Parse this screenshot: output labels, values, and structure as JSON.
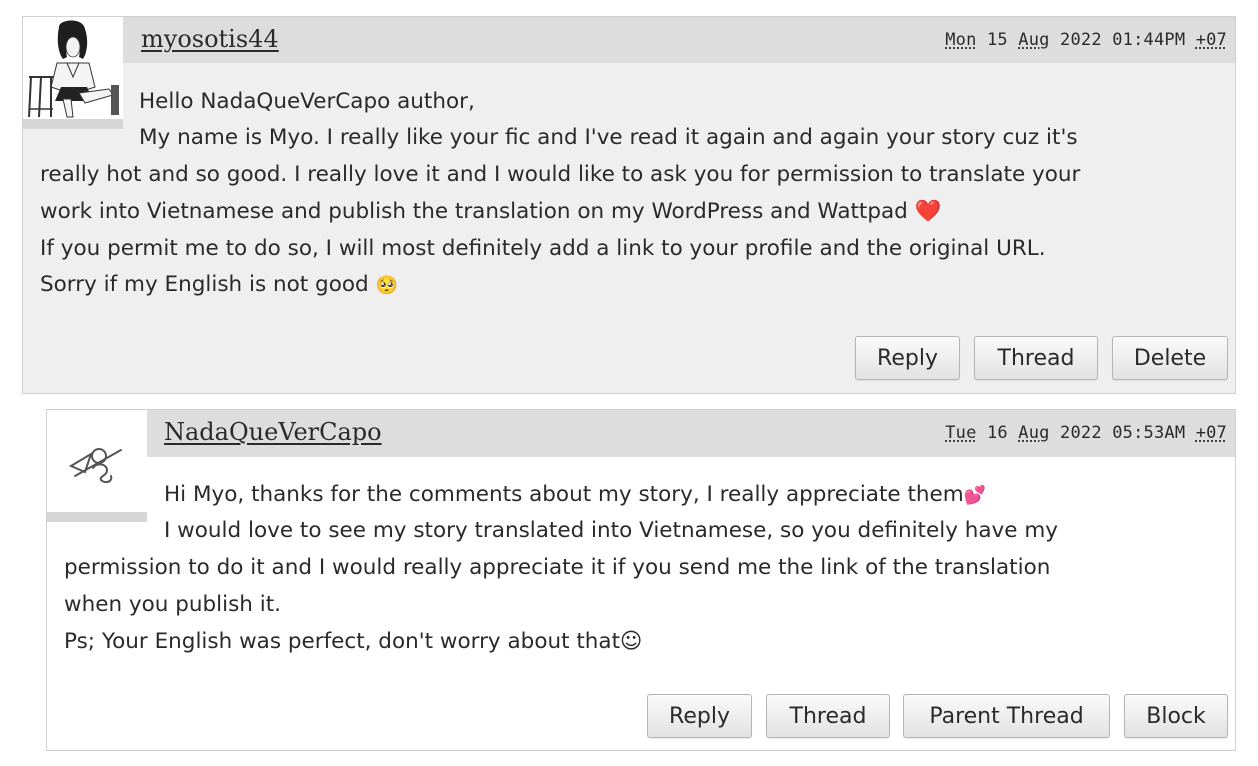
{
  "comments": [
    {
      "author": "myosotis44",
      "date": {
        "day_abbr": "Mon",
        "day": "15",
        "month_abbr": "Aug",
        "year_time": "2022 01:44PM",
        "tz": "+07"
      },
      "lines": [
        "Hello NadaQueVerCapo author,",
        "My name is Myo. I really like your fic and I've read it again and again your story cuz it's",
        "really hot and so good. I really love it and I would like to ask you for permission to translate your",
        "work into Vietnamese and publish the translation on my WordPress and Wattpad",
        "If you permit me to do so, I will most definitely add a link to your profile and the original URL.",
        "Sorry if my English is not good"
      ],
      "emoji_heart": "❤️",
      "emoji_pleading": "🥺",
      "buttons": [
        "Reply",
        "Thread",
        "Delete"
      ]
    },
    {
      "author": "NadaQueVerCapo",
      "date": {
        "day_abbr": "Tue",
        "day": "16",
        "month_abbr": "Aug",
        "year_time": "2022 05:53AM",
        "tz": "+07"
      },
      "lines": [
        "Hi Myo, thanks for the comments about my story, I really appreciate them",
        "I would love to see my story translated into Vietnamese, so you definitely have my",
        "permission to do it and I would really appreciate it if you send me the link of the translation",
        "when you publish it.",
        "Ps; Your English was perfect, don't worry about that"
      ],
      "emoji_hearts": "💕",
      "emoji_smile": "☺",
      "buttons": [
        "Reply",
        "Thread",
        "Parent Thread",
        "Block"
      ]
    }
  ],
  "colors": {
    "header_bg": "#dddddd",
    "comment1_bg": "#efefef",
    "comment2_bg": "#ffffff",
    "text": "#2a2a2a"
  }
}
